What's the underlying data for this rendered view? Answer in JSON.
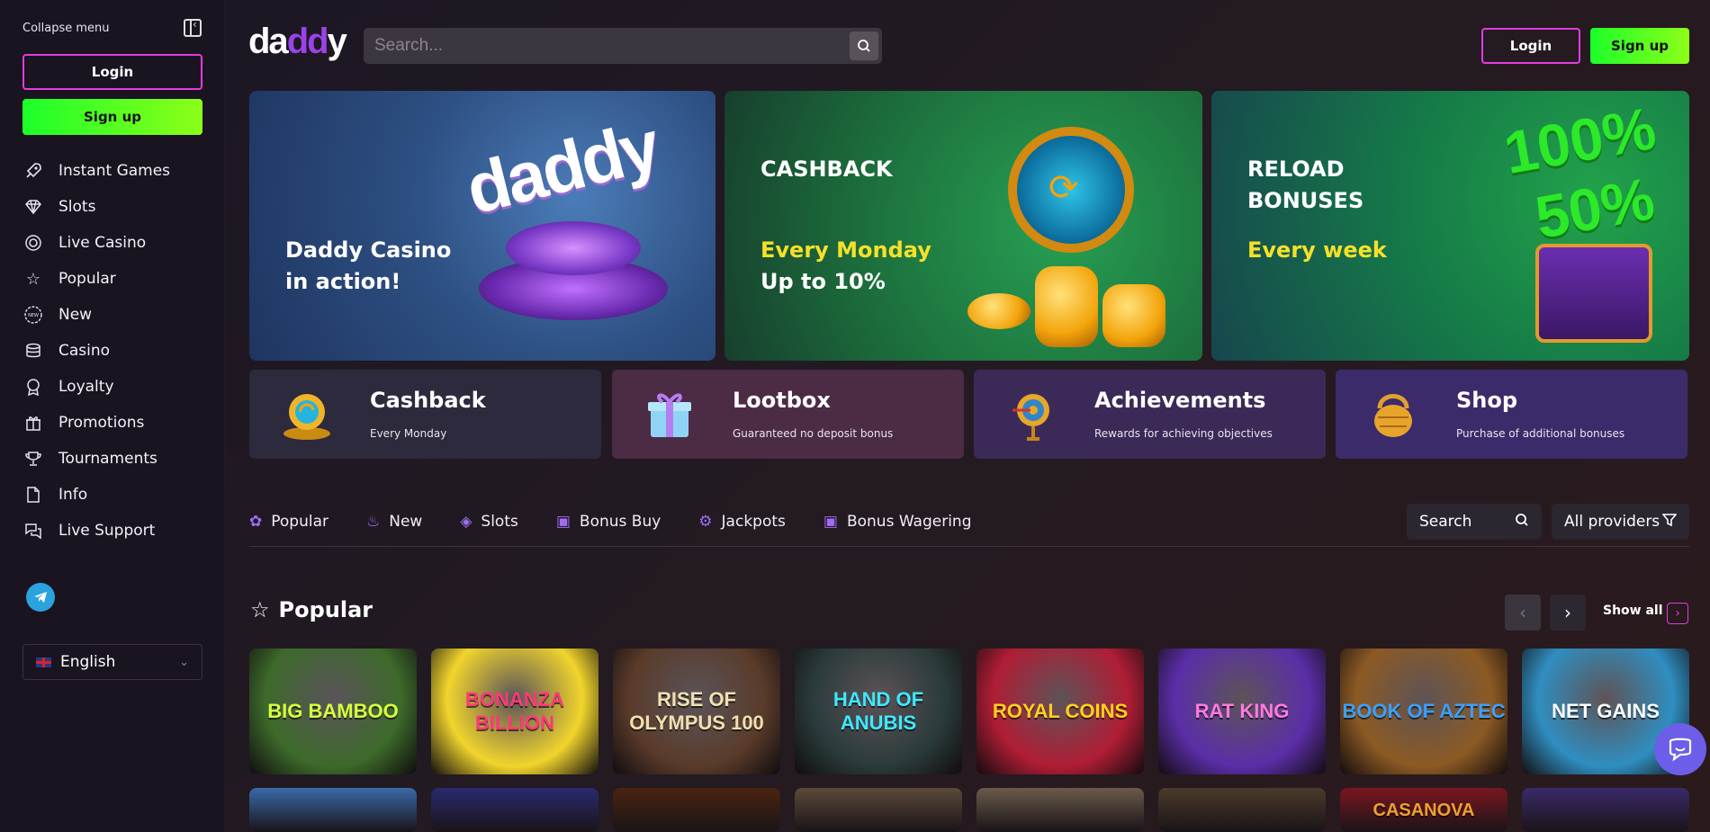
{
  "sidebar": {
    "collapse_label": "Collapse menu",
    "login_label": "Login",
    "signup_label": "Sign up",
    "items": [
      {
        "label": "Instant Games",
        "icon": "rocket-icon"
      },
      {
        "label": "Slots",
        "icon": "diamond-icon"
      },
      {
        "label": "Live Casino",
        "icon": "chip-icon"
      },
      {
        "label": "Popular",
        "icon": "star-icon"
      },
      {
        "label": "New",
        "icon": "new-badge-icon"
      },
      {
        "label": "Casino",
        "icon": "database-icon"
      },
      {
        "label": "Loyalty",
        "icon": "award-icon"
      },
      {
        "label": "Promotions",
        "icon": "gift-icon"
      },
      {
        "label": "Tournaments",
        "icon": "trophy-icon"
      },
      {
        "label": "Info",
        "icon": "document-icon"
      },
      {
        "label": "Live Support",
        "icon": "chat-icon"
      }
    ],
    "language": "English"
  },
  "header": {
    "logo_a": "da",
    "logo_b": "dd",
    "logo_c": "y",
    "search_placeholder": "Search...",
    "login_label": "Login",
    "signup_label": "Sign up"
  },
  "banners": [
    {
      "line1": "Daddy Casino",
      "line2": "in action!",
      "logo_text": "daddy"
    },
    {
      "title": "CASHBACK",
      "yellow": "Every Monday",
      "line": "Up to 10%"
    },
    {
      "title1": "RELOAD",
      "title2": "BONUSES",
      "yellow": "Every week",
      "pct1": "100%",
      "pct2": "50%"
    }
  ],
  "features": [
    {
      "title": "Cashback",
      "sub": "Every Monday"
    },
    {
      "title": "Lootbox",
      "sub": "Guaranteed no deposit bonus"
    },
    {
      "title": "Achievements",
      "sub": "Rewards for achieving objectives"
    },
    {
      "title": "Shop",
      "sub": "Purchase of additional bonuses"
    }
  ],
  "tabs": [
    {
      "label": "Popular",
      "icon": "popular-icon"
    },
    {
      "label": "New",
      "icon": "flame-icon"
    },
    {
      "label": "Slots",
      "icon": "diamond-icon"
    },
    {
      "label": "Bonus Buy",
      "icon": "bucket-icon"
    },
    {
      "label": "Jackpots",
      "icon": "jackpot-icon"
    },
    {
      "label": "Bonus Wagering",
      "icon": "bucket-icon"
    }
  ],
  "filters": {
    "search_label": "Search",
    "providers_label": "All providers"
  },
  "popular": {
    "title": "Popular",
    "show_all": "Show all",
    "games": [
      {
        "name": "BIG BAMBOO",
        "bg": "#3d6a2a"
      },
      {
        "name": "BONANZA BILLION",
        "bg": "#f1d52c"
      },
      {
        "name": "RISE OF OLYMPUS 100",
        "bg": "#5a3b2a"
      },
      {
        "name": "HAND OF ANUBIS",
        "bg": "#2a3a3a"
      },
      {
        "name": "ROYAL COINS",
        "bg": "#b01d35"
      },
      {
        "name": "RAT KING",
        "bg": "#5b2ea8"
      },
      {
        "name": "BOOK OF AZTEC",
        "bg": "#8c5a23"
      },
      {
        "name": "NET GAINS",
        "bg": "#2f8ec0"
      }
    ],
    "row2_names": [
      "",
      "",
      "",
      "",
      "",
      "",
      "CASANOVA",
      ""
    ]
  }
}
